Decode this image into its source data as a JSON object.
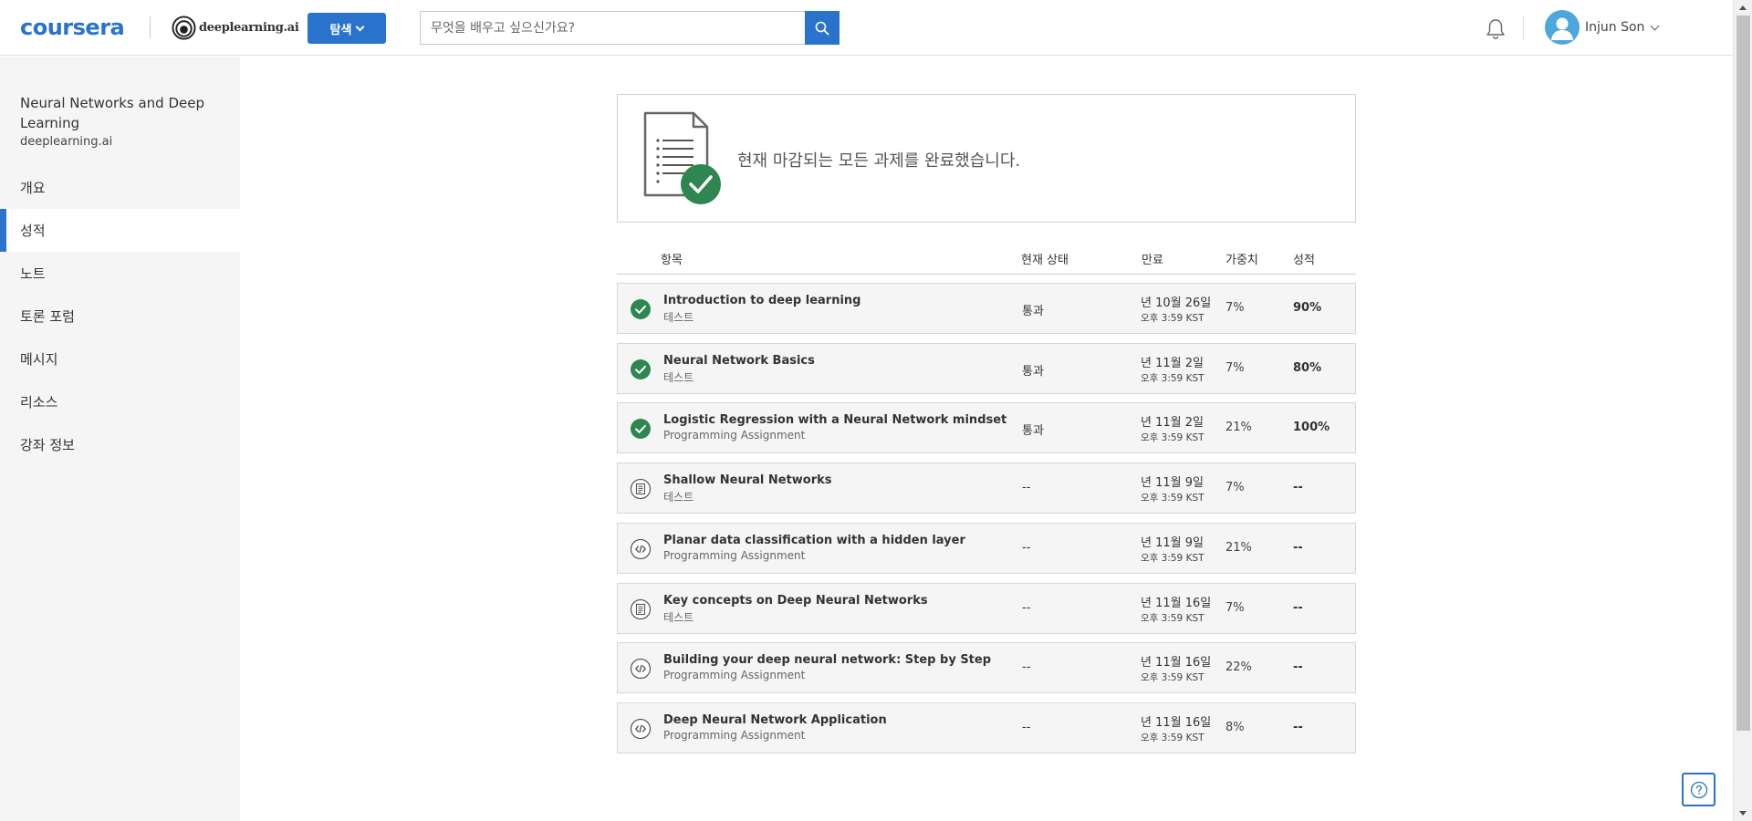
{
  "header": {
    "logo": "coursera",
    "partner_logo": "deeplearning.ai",
    "explore_label": "탐색",
    "search": {
      "placeholder": "무엇을 배우고 싶으신가요?",
      "value": ""
    },
    "user_name": "Injun Son",
    "accent_color": "#2a73cc"
  },
  "sidebar": {
    "course_title": "Neural Networks and Deep Learning",
    "course_provider": "deeplearning.ai",
    "items": [
      {
        "label": "개요",
        "active": false
      },
      {
        "label": "성적",
        "active": true
      },
      {
        "label": "노트",
        "active": false
      },
      {
        "label": "토론 포럼",
        "active": false
      },
      {
        "label": "메시지",
        "active": false
      },
      {
        "label": "리소스",
        "active": false
      },
      {
        "label": "강좌 정보",
        "active": false
      }
    ]
  },
  "banner": {
    "message": "현재 마감되는 모든 과제를 완료했습니다."
  },
  "table": {
    "headers": {
      "item": "항목",
      "status": "현재 상태",
      "due": "만료",
      "weight": "가중치",
      "grade": "성적"
    },
    "rows": [
      {
        "icon": "check-circle-icon",
        "name": "Introduction to deep learning",
        "type": "테스트",
        "status": "통과",
        "due_date": "년 10월 26일",
        "due_time": "오후 3:59 KST",
        "weight": "7%",
        "grade": "90%"
      },
      {
        "icon": "check-circle-icon",
        "name": "Neural Network Basics",
        "type": "테스트",
        "status": "통과",
        "due_date": "년 11월 2일",
        "due_time": "오후 3:59 KST",
        "weight": "7%",
        "grade": "80%"
      },
      {
        "icon": "check-circle-icon",
        "name": "Logistic Regression with a Neural Network mindset",
        "type": "Programming Assignment",
        "status": "통과",
        "due_date": "년 11월 2일",
        "due_time": "오후 3:59 KST",
        "weight": "21%",
        "grade": "100%"
      },
      {
        "icon": "quiz-list-icon",
        "name": "Shallow Neural Networks",
        "type": "테스트",
        "status": "--",
        "due_date": "년 11월 9일",
        "due_time": "오후 3:59 KST",
        "weight": "7%",
        "grade": "--"
      },
      {
        "icon": "code-icon",
        "name": "Planar data classification with a hidden layer",
        "type": "Programming Assignment",
        "status": "--",
        "due_date": "년 11월 9일",
        "due_time": "오후 3:59 KST",
        "weight": "21%",
        "grade": "--"
      },
      {
        "icon": "quiz-list-icon",
        "name": "Key concepts on Deep Neural Networks",
        "type": "테스트",
        "status": "--",
        "due_date": "년 11월 16일",
        "due_time": "오후 3:59 KST",
        "weight": "7%",
        "grade": "--"
      },
      {
        "icon": "code-icon",
        "name": "Building your deep neural network: Step by Step",
        "type": "Programming Assignment",
        "status": "--",
        "due_date": "년 11월 16일",
        "due_time": "오후 3:59 KST",
        "weight": "22%",
        "grade": "--"
      },
      {
        "icon": "code-icon",
        "name": "Deep Neural Network Application",
        "type": "Programming Assignment",
        "status": "--",
        "due_date": "년 11월 16일",
        "due_time": "오후 3:59 KST",
        "weight": "8%",
        "grade": "--"
      }
    ]
  },
  "colors": {
    "success": "#2e8650",
    "brand": "#2a73cc"
  }
}
